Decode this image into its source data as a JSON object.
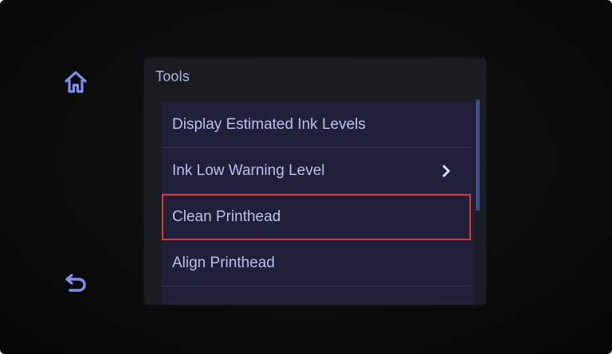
{
  "screen": {
    "title": "Tools"
  },
  "icons": {
    "home": "home-icon",
    "back": "back-arrow-icon",
    "chevron": "chevron-right-icon"
  },
  "menu": {
    "items": [
      {
        "label": "Display Estimated Ink Levels",
        "has_submenu": false,
        "selected": false
      },
      {
        "label": "Ink Low Warning Level",
        "has_submenu": true,
        "selected": false
      },
      {
        "label": "Clean Printhead",
        "has_submenu": false,
        "selected": true
      },
      {
        "label": "Align Printhead",
        "has_submenu": false,
        "selected": false
      }
    ]
  },
  "colors": {
    "text": "#b9c0f0",
    "highlight": "#d9392c",
    "icon": "#7f8ff0"
  }
}
